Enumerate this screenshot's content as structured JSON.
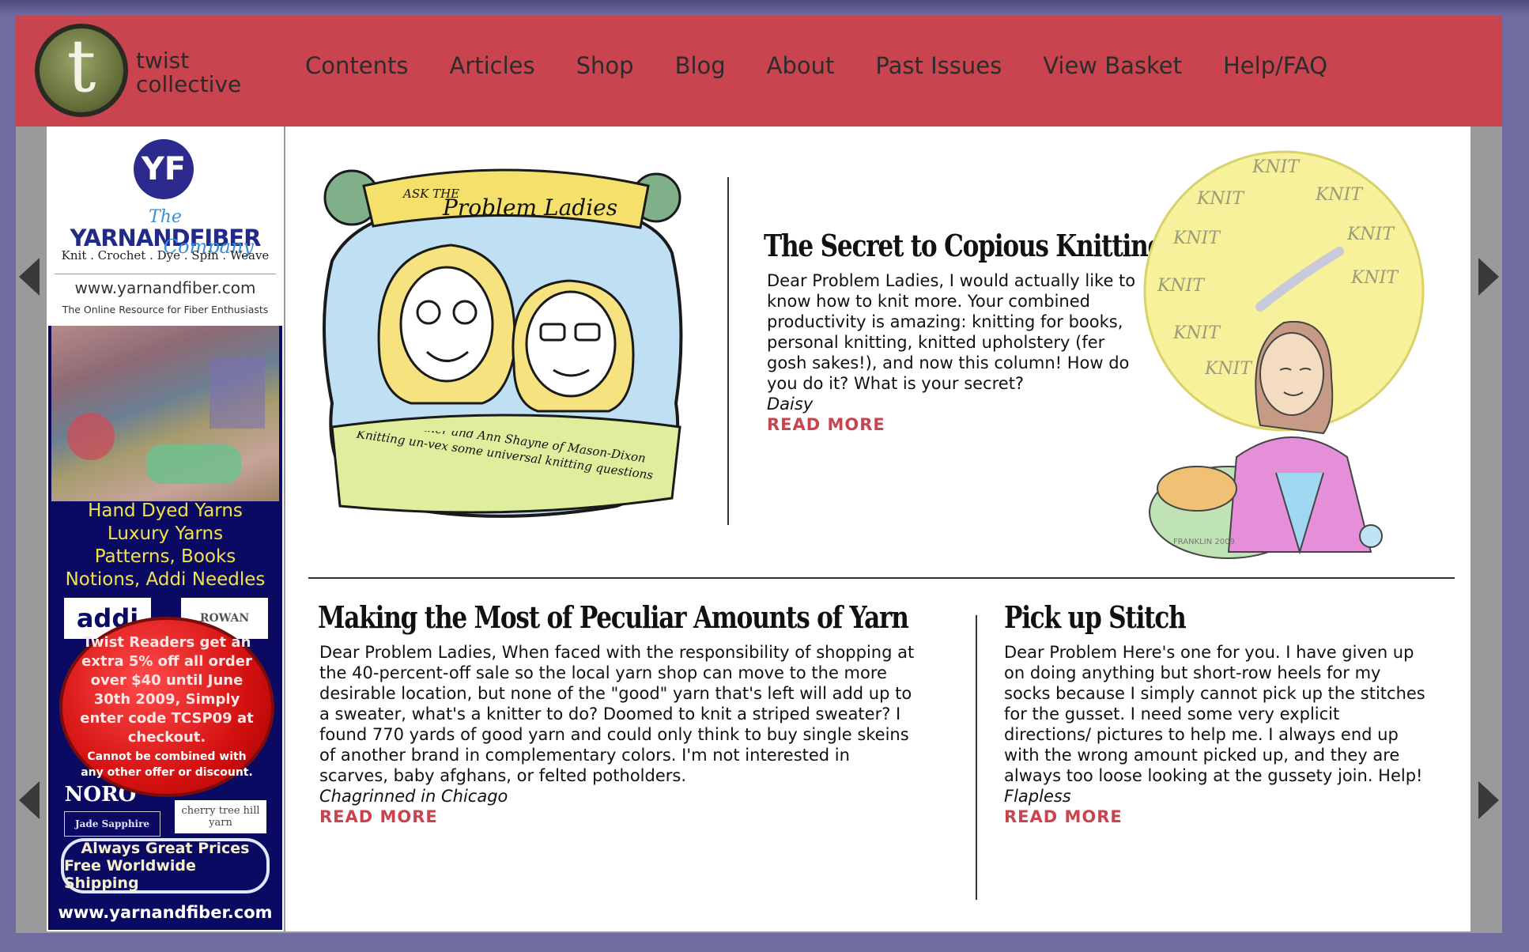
{
  "brand": {
    "line1": "twist",
    "line2": "collective",
    "initial": "t"
  },
  "nav": [
    "Contents",
    "Articles",
    "Shop",
    "Blog",
    "About",
    "Past Issues",
    "View Basket",
    "Help/FAQ"
  ],
  "ad": {
    "logo_letters": "YF",
    "name_the": "The",
    "name_main": "YARNANDFIBER",
    "name_company": "Company",
    "crafts": "Knit . Crochet . Dye . Spin . Weave",
    "url_top": "www.yarnandfiber.com",
    "tagline": "The Online Resource for Fiber Enthusiasts",
    "features": [
      "Hand Dyed Yarns",
      "Luxury Yarns",
      "Patterns, Books",
      "Notions, Addi Needles"
    ],
    "brands": [
      "addi",
      "NORO",
      "ROWAN",
      "Jade Sapphire",
      "cherry tree hill yarn"
    ],
    "promo_line1": "Twist Readers get an extra 5% off all order over $40 until June 30th 2009, Simply enter code TCSP09 at checkout.",
    "promo_line2": "Cannot be combined with any other offer or discount.",
    "badge_line1": "Always Great Prices",
    "badge_line2": "Free Worldwide Shipping",
    "url_bottom": "www.yarnandfiber.com"
  },
  "illustration1": {
    "banner_ask": "ASK THE",
    "banner_title": "Problem Ladies",
    "caption": "Kay Gardiner and Ann Shayne of Mason-Dixon Knitting un-vex some universal knitting questions"
  },
  "illustration2": {
    "word": "KNIT",
    "signature": "FRANKLIN 2009"
  },
  "articles": [
    {
      "title": "The Secret to Copious Knitting",
      "body": "Dear Problem Ladies, I would actually like to know how to knit more. Your combined productivity is amazing: knitting for books, personal knitting, knitted upholstery (fer gosh sakes!), and now this column! How do you do it? What is your secret?",
      "signature": "Daisy",
      "more": "READ MORE"
    },
    {
      "title": "Making the Most of Peculiar Amounts of Yarn",
      "body": "Dear Problem Ladies, When faced with the responsibility of shopping at the 40-percent-off sale so the local yarn shop can move to the more desirable location, but none of the \"good\" yarn that's left will add up to a sweater, what's a knitter to do? Doomed to knit a striped sweater? I found 770 yards of good yarn and could only think to buy single skeins of another brand in complementary colors. I'm not interested in scarves, baby afghans, or felted potholders.",
      "signature": "Chagrinned in Chicago",
      "more": "READ MORE"
    },
    {
      "title": "Pick up Stitch",
      "body": "Dear Problem Here's one for you. I have given up on doing anything but short-row heels for my socks because I simply cannot pick up the stitches for the gusset. I need some very explicit directions/ pictures to help me. I always end up with the wrong amount picked up, and they are always too loose looking at the gussety join. Help!",
      "signature": "Flapless",
      "more": "READ MORE"
    }
  ]
}
